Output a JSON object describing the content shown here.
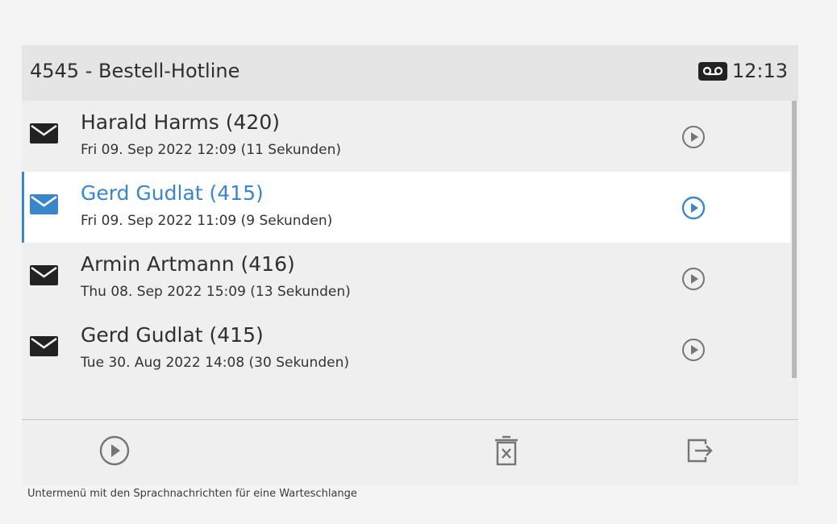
{
  "header": {
    "title": "4545 - Bestell-Hotline",
    "time": "12:13",
    "voicemail_icon": "voicemail-icon"
  },
  "messages": [
    {
      "name": "Harald Harms (420)",
      "datetime": "Fri 09. Sep 2022 12:09 (11 Sekunden)",
      "selected": false
    },
    {
      "name": "Gerd Gudlat (415)",
      "datetime": "Fri 09. Sep 2022 11:09 (9 Sekunden)",
      "selected": true
    },
    {
      "name": "Armin Artmann (416)",
      "datetime": "Thu 08. Sep 2022 15:09 (13 Sekunden)",
      "selected": false
    },
    {
      "name": "Gerd Gudlat (415)",
      "datetime": "Tue 30. Aug 2022 14:08 (30 Sekunden)",
      "selected": false
    }
  ],
  "footer": {
    "buttons": [
      "play-icon",
      "trash-icon",
      "exit-icon"
    ]
  },
  "caption": "Untermenü mit den Sprachnachrichten für eine Warteschlange",
  "colors": {
    "accent": "#3a86cd",
    "text": "#2f2f2f",
    "icon": "#757575"
  }
}
